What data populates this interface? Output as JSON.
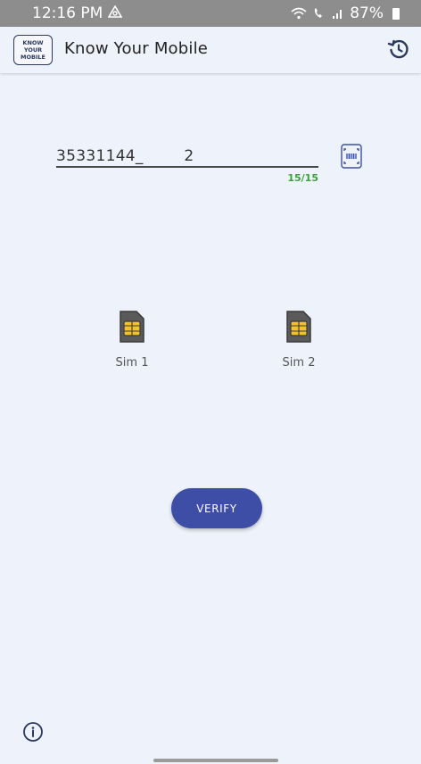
{
  "status_bar": {
    "time": "12:16 PM",
    "battery": "87%"
  },
  "app_bar": {
    "logo_lines": [
      "KNOW",
      "YOUR",
      "MOBILE"
    ],
    "title": "Know Your Mobile"
  },
  "imei_field": {
    "value": "35331144_        2",
    "counter": "15/15"
  },
  "sims": [
    {
      "label": "Sim 1"
    },
    {
      "label": "Sim 2"
    }
  ],
  "verify_button": {
    "label": "VERIFY"
  },
  "icons": {
    "history": "history-icon",
    "scan": "barcode-scan-icon",
    "sim": "sim-card-icon",
    "info": "info-icon"
  },
  "colors": {
    "primary": "#3e4ea6",
    "background": "#eef2fa",
    "counter": "#3aa23a",
    "sim_accent": "#f2c12e"
  }
}
